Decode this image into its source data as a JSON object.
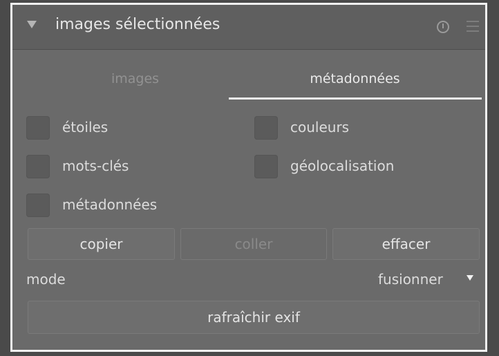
{
  "module": {
    "title": "images sélectionnées",
    "icons": [
      "collapse-arrow-icon",
      "reset-icon",
      "presets-menu-icon"
    ]
  },
  "tabs": [
    {
      "label": "images",
      "active": false
    },
    {
      "label": "métadonnées",
      "active": true
    }
  ],
  "options": [
    {
      "label": "étoiles",
      "checked": false
    },
    {
      "label": "couleurs",
      "checked": false
    },
    {
      "label": "mots-clés",
      "checked": false
    },
    {
      "label": "géolocalisation",
      "checked": false
    },
    {
      "label": "métadonnées",
      "checked": false
    }
  ],
  "buttons": {
    "copy": "copier",
    "paste": "coller",
    "clear": "effacer"
  },
  "mode": {
    "label": "mode",
    "value": "fusionner"
  },
  "refresh_exif": "rafraîchir exif"
}
